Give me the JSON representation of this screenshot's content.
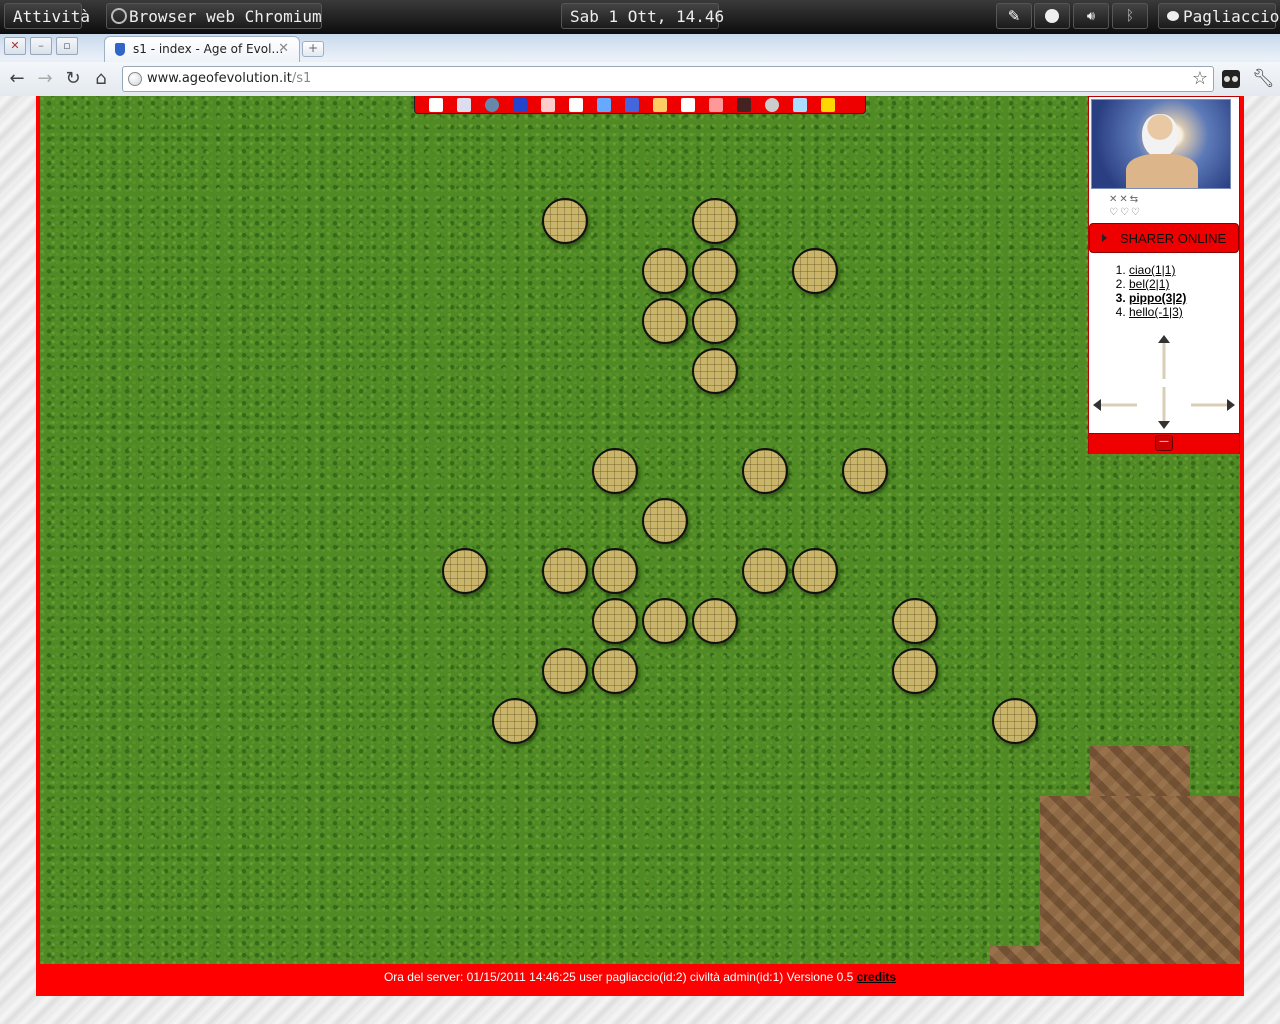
{
  "os_panel": {
    "activities": "Attività",
    "app_name": "Browser web Chromium",
    "clock": "Sab  1 Ott, 14.46",
    "user": "Pagliaccio"
  },
  "browser": {
    "tab_title": "s1 - index - Age of Evol…",
    "url_host": "www.ageofevolution.it",
    "url_path": "/s1"
  },
  "game": {
    "menu_icons": [
      "home-icon",
      "users-icon",
      "globe-icon",
      "soldier-icon",
      "mushroom-icon",
      "scroll-icon",
      "buildings-icon",
      "map-icon",
      "trade-icon",
      "mail-icon",
      "mushroom-alt-icon",
      "fire-icon",
      "shield-icon",
      "feather-icon",
      "crown-icon"
    ],
    "villages": [
      {
        "col": 2,
        "row": 1
      },
      {
        "col": 5,
        "row": 1
      },
      {
        "col": 4,
        "row": 2
      },
      {
        "col": 5,
        "row": 2
      },
      {
        "col": 7,
        "row": 2
      },
      {
        "col": 4,
        "row": 3
      },
      {
        "col": 5,
        "row": 3
      },
      {
        "col": 5,
        "row": 4
      },
      {
        "col": 3,
        "row": 6
      },
      {
        "col": 6,
        "row": 6
      },
      {
        "col": 8,
        "row": 6
      },
      {
        "col": 4,
        "row": 7
      },
      {
        "col": 0,
        "row": 8
      },
      {
        "col": 2,
        "row": 8
      },
      {
        "col": 3,
        "row": 8
      },
      {
        "col": 6,
        "row": 8
      },
      {
        "col": 7,
        "row": 8
      },
      {
        "col": 3,
        "row": 9
      },
      {
        "col": 4,
        "row": 9
      },
      {
        "col": 5,
        "row": 9
      },
      {
        "col": 9,
        "row": 9
      },
      {
        "col": 2,
        "row": 10
      },
      {
        "col": 3,
        "row": 10
      },
      {
        "col": 9,
        "row": 10
      },
      {
        "col": 1,
        "row": 11
      },
      {
        "col": 11,
        "row": 11
      }
    ],
    "side_panel": {
      "sharer_label": "SHARER ONLINE",
      "users": [
        {
          "label": "ciao(1|1)",
          "current": false
        },
        {
          "label": "bel(2|1)",
          "current": false
        },
        {
          "label": "pippo(3|2)",
          "current": true
        },
        {
          "label": "hello(-1|3)",
          "current": false
        }
      ],
      "collapse_label": "—"
    },
    "status": {
      "text": "Ora del server: 01/15/2011 14:46:25 user pagliaccio(id:2) civiltà admin(id:1) Versione 0.5",
      "credits": "credits"
    }
  },
  "colors": {
    "frame_red": "#ff0000",
    "grass": "#4f8a24",
    "village_fill": "#c8b56a"
  }
}
